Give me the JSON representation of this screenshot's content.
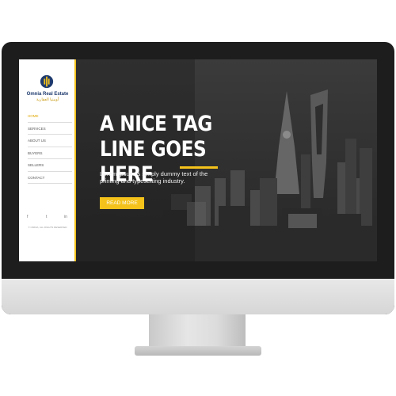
{
  "brand": {
    "name": "Omnia Real Estate",
    "name_arabic": "أومنيا العقارية",
    "logo_icon": "omnia-logo-icon",
    "colors": {
      "accent": "#f4c21b",
      "navy": "#1f3b6e"
    }
  },
  "sidebar": {
    "items": [
      {
        "label": "Home",
        "active": true
      },
      {
        "label": "Services"
      },
      {
        "label": "About Us"
      },
      {
        "label": "Buyers"
      },
      {
        "label": "Sellers"
      },
      {
        "label": "Contact"
      }
    ],
    "socials": [
      {
        "icon": "facebook-icon",
        "glyph": "f"
      },
      {
        "icon": "twitter-icon",
        "glyph": "t"
      },
      {
        "icon": "linkedin-icon",
        "glyph": "in"
      }
    ],
    "copyright": "© OMNIA, ALL RIGHTS RESERVED"
  },
  "hero": {
    "title_line1": "A NICE TAG",
    "title_line2": "LINE GOES HERE",
    "description": "Lorem Ipsum is simply dummy text of the printing and typesetting industry.",
    "cta_label": "READ MORE"
  }
}
